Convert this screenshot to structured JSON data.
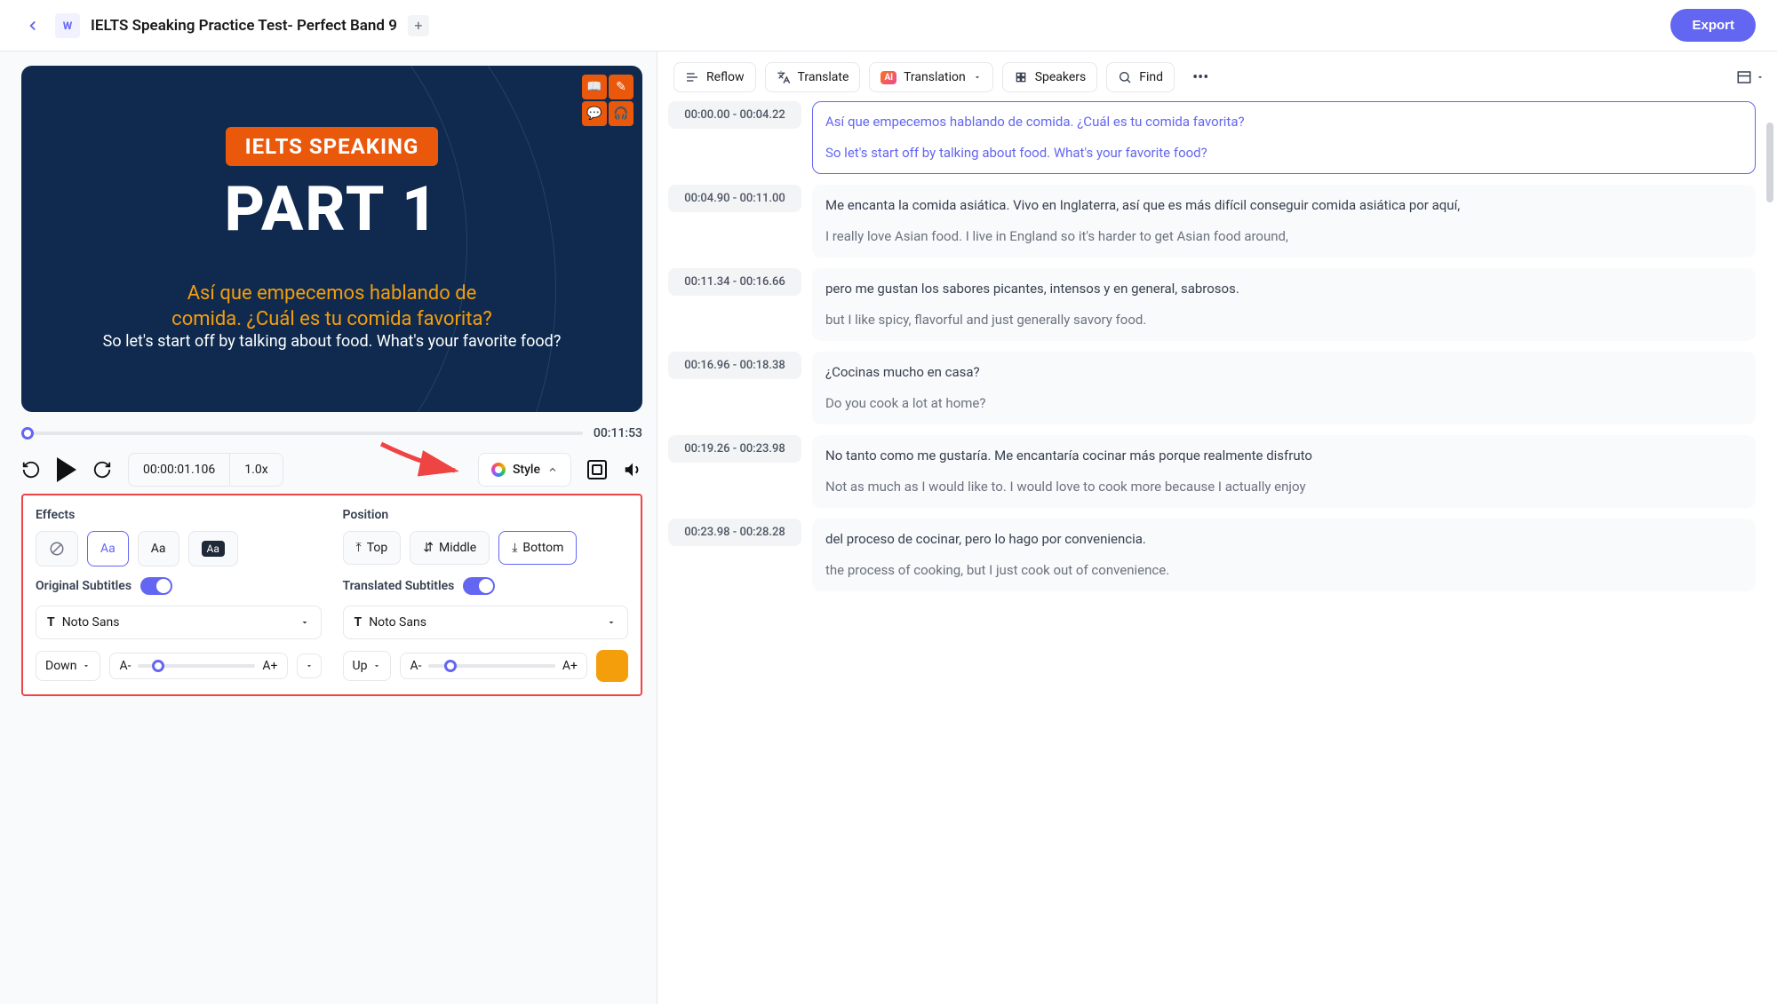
{
  "header": {
    "title": "IELTS Speaking Practice Test- Perfect Band 9",
    "export_label": "Export"
  },
  "video": {
    "badge": "IELTS SPEAKING",
    "big_title": "PART 1",
    "subtitle_translated_l1": "Así que empecemos hablando de",
    "subtitle_translated_l2": "comida. ¿Cuál es tu comida favorita?",
    "subtitle_original": "So let's start off by talking about food. What's your favorite food?"
  },
  "player": {
    "total_time": "00:11:53",
    "current_time": "00:00:01.106",
    "speed": "1.0x",
    "style_label": "Style"
  },
  "style_panel": {
    "effects_label": "Effects",
    "position_label": "Position",
    "pos_top": "Top",
    "pos_middle": "Middle",
    "pos_bottom": "Bottom",
    "original_subtitles_label": "Original Subtitles",
    "translated_subtitles_label": "Translated Subtitles",
    "font_original": "Noto Sans",
    "font_translated": "Noto Sans",
    "dir_down": "Down",
    "dir_up": "Up",
    "size_minus": "A-",
    "size_plus": "A+"
  },
  "toolbar": {
    "reflow": "Reflow",
    "translate": "Translate",
    "translation": "Translation",
    "speakers": "Speakers",
    "find": "Find"
  },
  "segments": [
    {
      "time": "00:00.00 - 00:04.22",
      "translated": "Así que empecemos hablando de comida. ¿Cuál es tu comida favorita?",
      "original": "So let's start off by talking about food. What's your favorite food?",
      "active": true
    },
    {
      "time": "00:04.90 - 00:11.00",
      "translated": "Me encanta la comida asiática. Vivo en Inglaterra, así que es más difícil conseguir comida asiática por aquí,",
      "original": "I really love Asian food. I live in England so it's harder to get Asian food around,"
    },
    {
      "time": "00:11.34 - 00:16.66",
      "translated": "pero me gustan los sabores picantes, intensos y en general, sabrosos.",
      "original": "but I like spicy, flavorful and just generally savory food."
    },
    {
      "time": "00:16.96 - 00:18.38",
      "translated": "¿Cocinas mucho en casa?",
      "original": "Do you cook a lot at home?"
    },
    {
      "time": "00:19.26 - 00:23.98",
      "translated": "No tanto como me gustaría. Me encantaría cocinar más porque realmente disfruto",
      "original": "Not as much as I would like to. I would love to cook more because I actually enjoy"
    },
    {
      "time": "00:23.98 - 00:28.28",
      "translated": "del proceso de cocinar, pero lo hago por conveniencia.",
      "original": "the process of cooking, but I just cook out of convenience."
    }
  ]
}
